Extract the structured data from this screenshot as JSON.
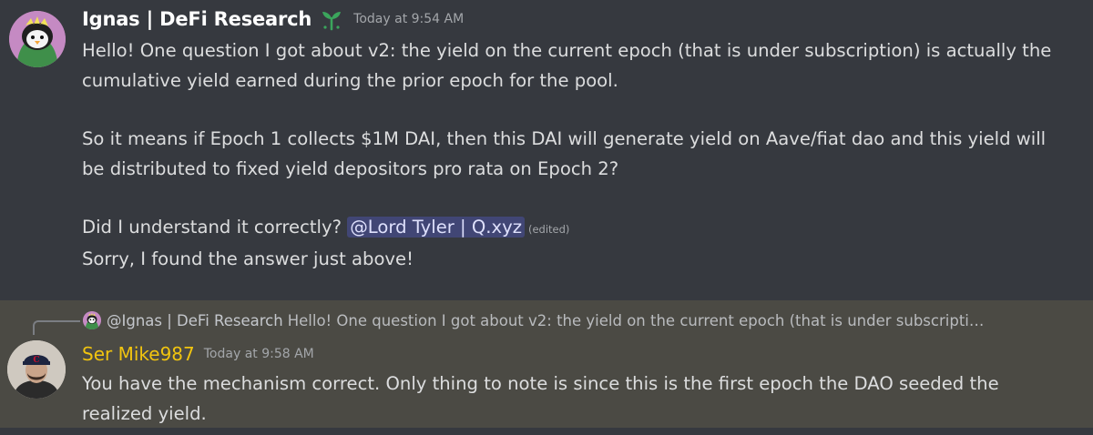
{
  "colors": {
    "background": "#36393f",
    "highlight_background": "#4b4a44",
    "mention_background": "#414675",
    "mention_text": "#dee0fc",
    "username_mike": "#f1c40f"
  },
  "message1": {
    "author": "Ignas  | DeFi Research",
    "badge_icon": "sprout-icon",
    "timestamp": "Today at 9:54 AM",
    "para1": "Hello! One question I got about v2: the yield on the current epoch (that is under subscription) is actually the cumulative yield earned during the prior epoch for the pool.",
    "para2": "So it means if Epoch 1 collects $1M DAI, then this DAI will generate yield on Aave/fiat dao and this yield will be distributed to fixed yield depositors pro rata on Epoch 2?",
    "para3_text": "Did I understand it correctly? ",
    "mention": "@Lord Tyler | Q.xyz",
    "edited": "(edited)",
    "para4": "Sorry, I found the answer just above!"
  },
  "message2": {
    "reply": {
      "author": "@Ignas  | DeFi Research",
      "text": "Hello! One question I got about v2: the yield on the current epoch (that is under subscripti…"
    },
    "author": "Ser Mike987",
    "timestamp": "Today at 9:58 AM",
    "text": "You have the mechanism correct. Only thing to note is since this is the first epoch the DAO seeded the realized yield."
  }
}
